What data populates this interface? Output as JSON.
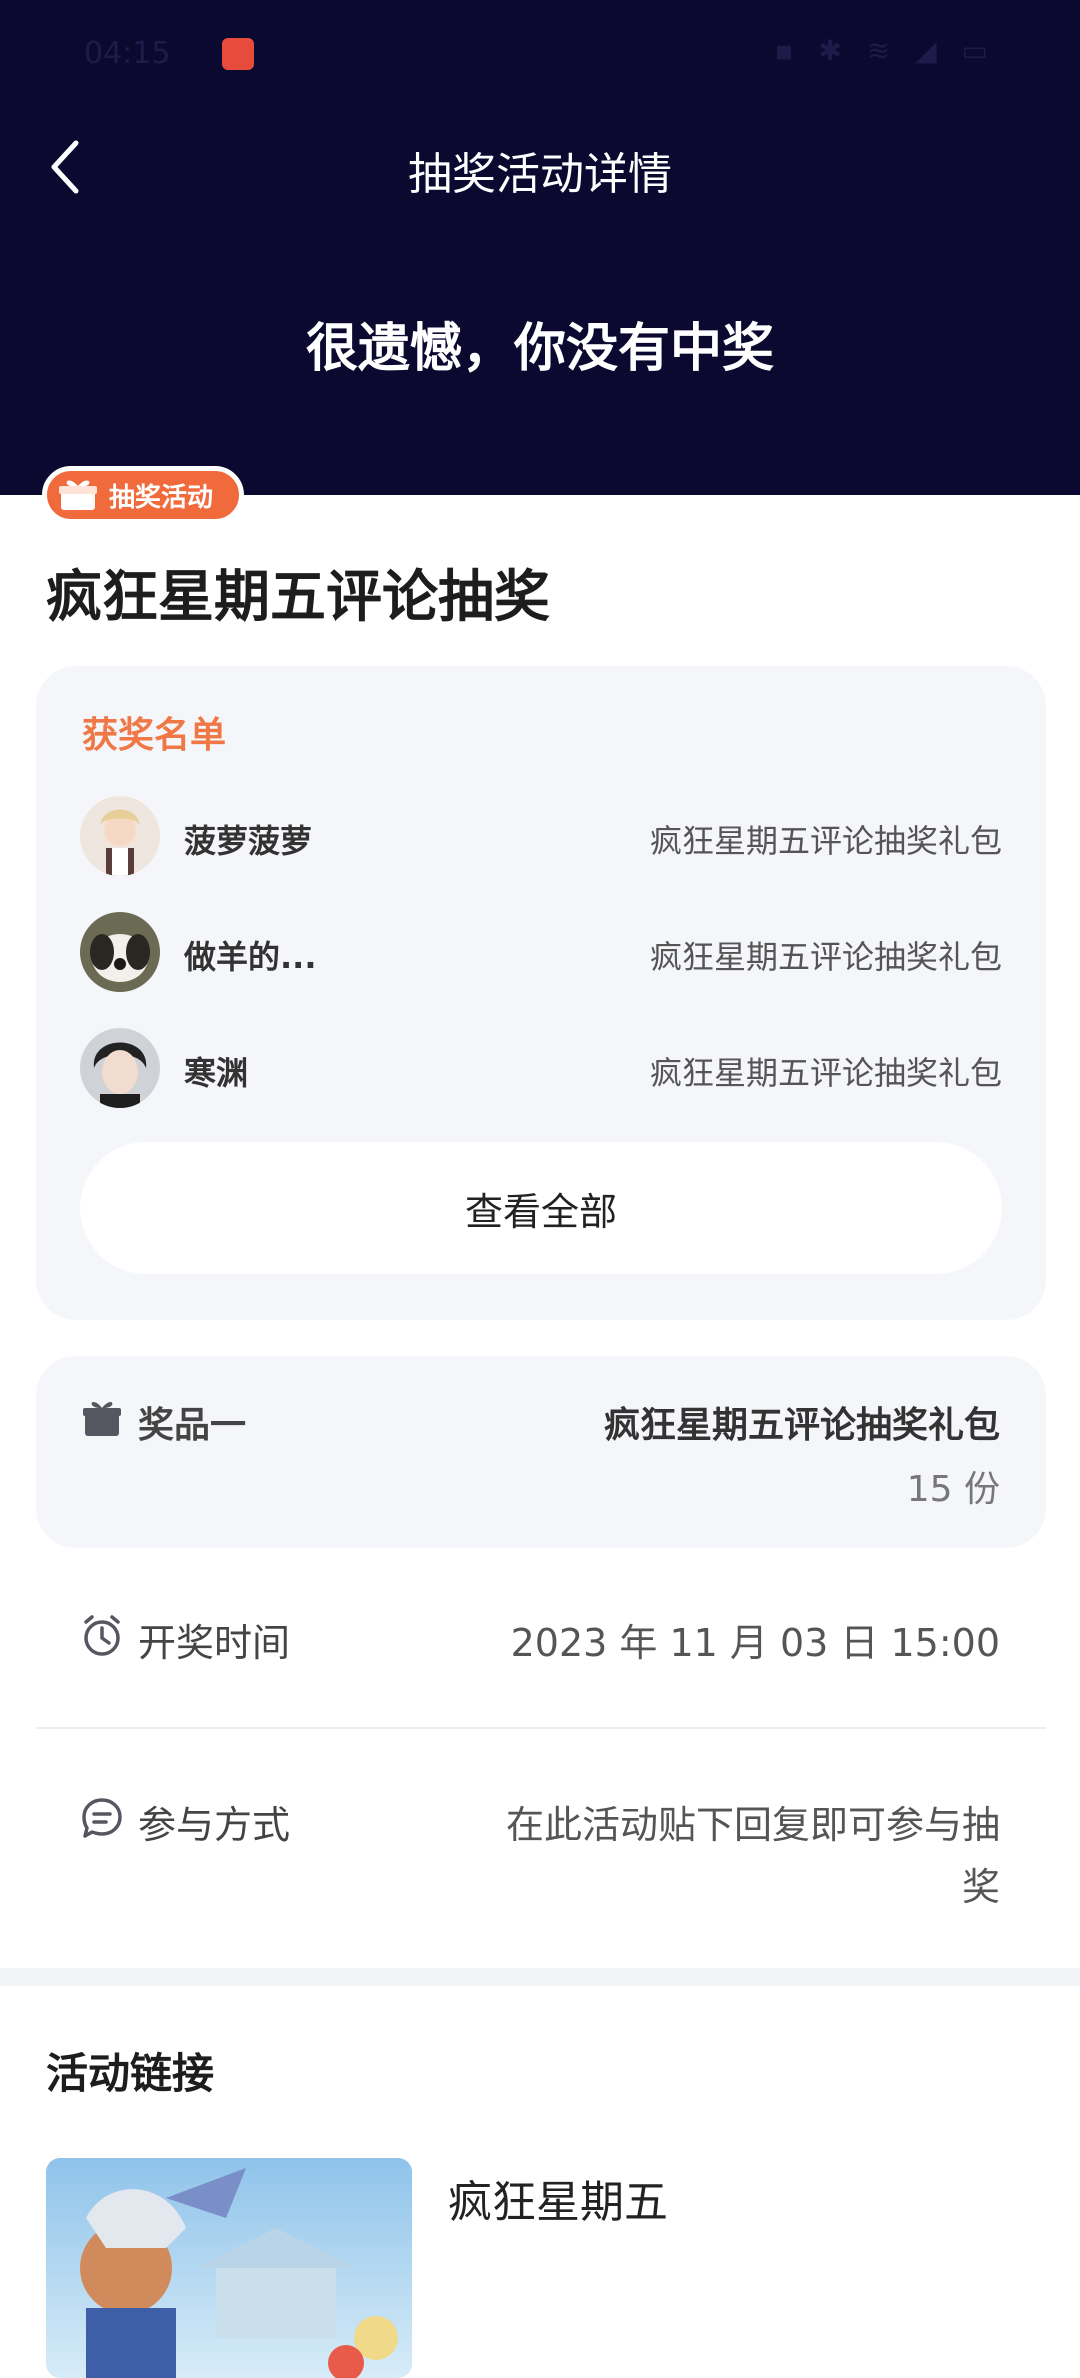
{
  "status_bar": {
    "time": "04:15"
  },
  "nav": {
    "title": "抽奖活动详情"
  },
  "result": {
    "message": "很遗憾，你没有中奖"
  },
  "activity": {
    "tag_label": "抽奖活动",
    "title": "疯狂星期五评论抽奖"
  },
  "winners": {
    "heading": "获奖名单",
    "list": [
      {
        "name": "菠萝菠萝",
        "prize": "疯狂星期五评论抽奖礼包"
      },
      {
        "name": "做羊的...",
        "prize": "疯狂星期五评论抽奖礼包"
      },
      {
        "name": "寒渊",
        "prize": "疯狂星期五评论抽奖礼包"
      }
    ],
    "view_all_label": "查看全部"
  },
  "prize": {
    "label": "奖品一",
    "name": "疯狂星期五评论抽奖礼包",
    "quantity": "15 份"
  },
  "draw_time": {
    "label": "开奖时间",
    "value": "2023 年 11 月 03 日 15:00"
  },
  "participation": {
    "label": "参与方式",
    "value_line1": "在此活动贴下回复即可参与抽",
    "value_line2": "奖"
  },
  "links": {
    "heading": "活动链接",
    "items": [
      {
        "title": "疯狂星期五"
      }
    ]
  },
  "colors": {
    "header_bg": "#0b0930",
    "accent_orange": "#f06a3c",
    "card_bg": "#f5f6f9"
  }
}
